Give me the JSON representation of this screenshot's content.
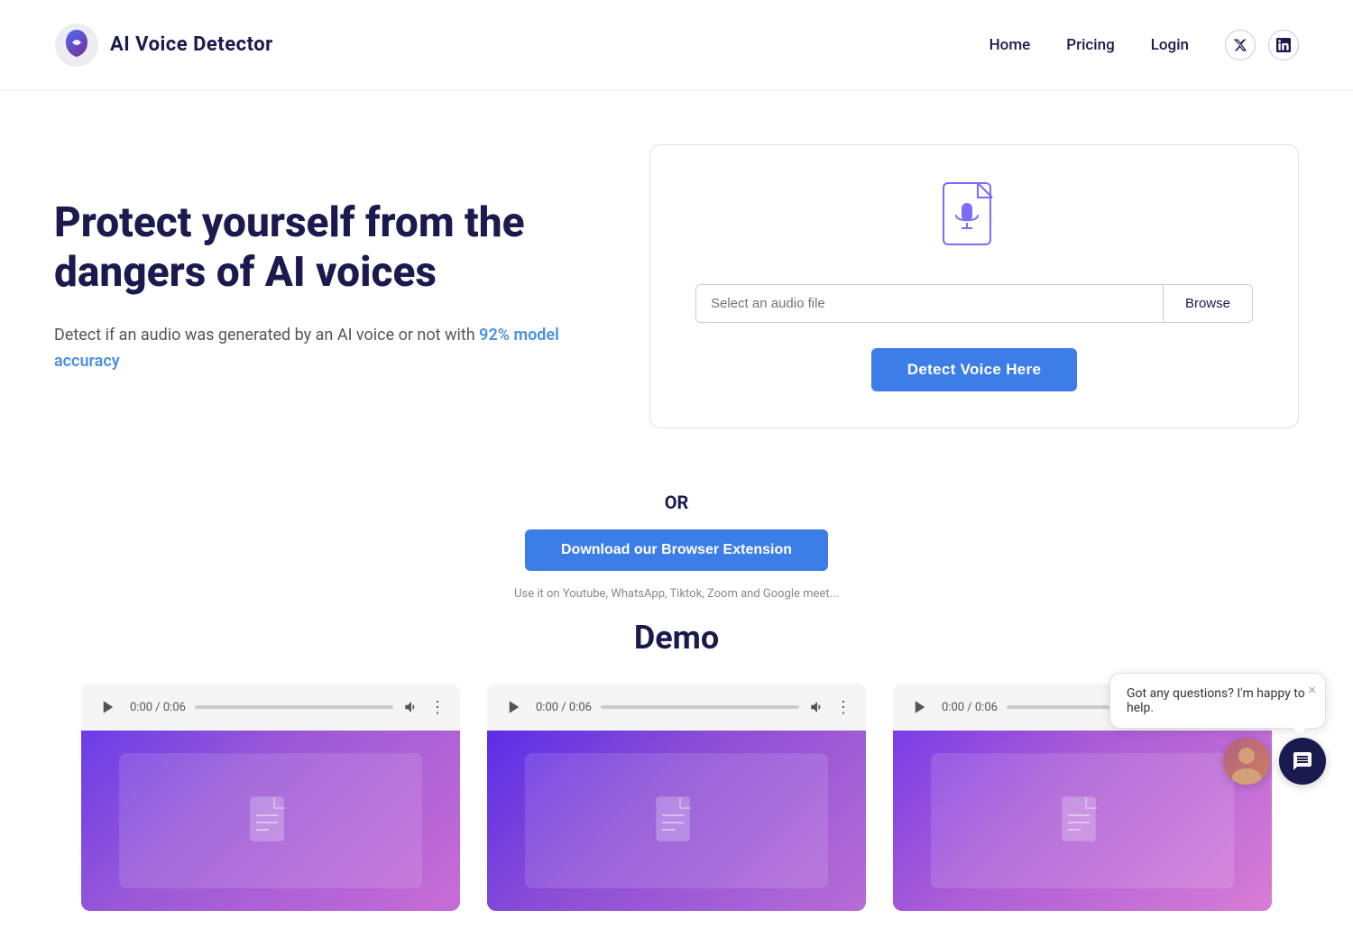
{
  "header": {
    "logo_text": "AI Voice Detector",
    "nav": {
      "home": "Home",
      "pricing": "Pricing",
      "login": "Login"
    },
    "social": {
      "twitter": "𝕏",
      "linkedin": "in"
    }
  },
  "hero": {
    "title": "Protect yourself from the dangers of AI voices",
    "subtitle_prefix": "Detect if an audio was generated by an AI voice or not with ",
    "highlight": "92% model accuracy",
    "subtitle_suffix": ""
  },
  "upload": {
    "file_placeholder": "Select an audio file",
    "browse_label": "Browse",
    "detect_label": "Detect Voice Here"
  },
  "or_section": {
    "or_label": "OR",
    "extension_label": "Download our Browser Extension",
    "note": "Use it on Youtube, WhatsApp, Tiktok, Zoom and Google meet..."
  },
  "demo": {
    "title": "Demo",
    "cards": [
      {
        "time": "0:00 / 0:06"
      },
      {
        "time": "0:00 / 0:06"
      },
      {
        "time": "0:00 / 0:06"
      }
    ]
  },
  "chat": {
    "bubble_text": "Got any questions? I'm happy to help.",
    "close_label": "×"
  }
}
